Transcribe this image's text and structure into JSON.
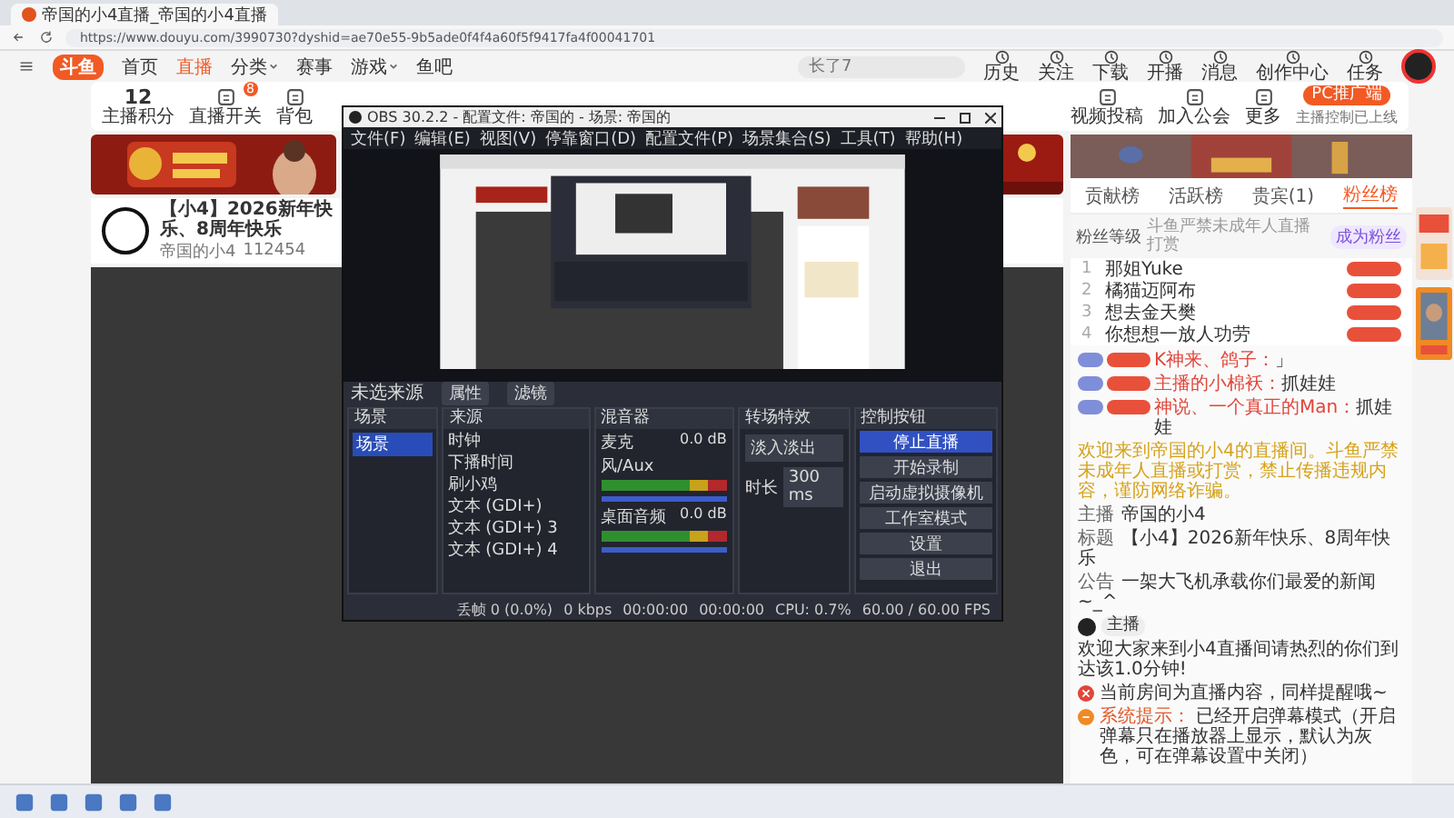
{
  "browser": {
    "tab_title": "帝国的小4直播_帝国的小4直播",
    "url": "https://www.douyu.com/3990730?dyshid=ae70e55-9b5ade0f4f4a60f5f9417fa4f00041701"
  },
  "site_nav": {
    "logo": "斗鱼",
    "items": [
      {
        "label": "首页",
        "selected": false,
        "menu": false
      },
      {
        "label": "直播",
        "selected": true,
        "menu": false
      },
      {
        "label": "分类",
        "selected": false,
        "menu": true
      },
      {
        "label": "赛事",
        "selected": false,
        "menu": false
      },
      {
        "label": "游戏",
        "selected": false,
        "menu": true
      },
      {
        "label": "鱼吧",
        "selected": false,
        "menu": false
      }
    ]
  },
  "search": {
    "placeholder": "长了7"
  },
  "header_links": [
    "历史",
    "关注",
    "下载",
    "开播",
    "消息",
    "创作中心",
    "任务"
  ],
  "toolbar": {
    "score": "12",
    "left": [
      {
        "label": "主播积分"
      },
      {
        "label": "直播开关",
        "badge": "8"
      },
      {
        "label": "背包"
      }
    ],
    "right": [
      {
        "label": "视频投稿"
      },
      {
        "label": "加入公会"
      },
      {
        "label": "更多"
      }
    ],
    "promo_button": "PC推广端",
    "promo_note": "主播控制已上线"
  },
  "room": {
    "title": "【小4】2026新年快乐、8周年快乐",
    "streamer": "帝国的小4",
    "heat": "112454"
  },
  "obs": {
    "title": "OBS 30.2.2 - 配置文件: 帝国的 - 场景: 帝国的",
    "menu": [
      "文件(F)",
      "编辑(E)",
      "视图(V)",
      "停靠窗口(D)",
      "配置文件(P)",
      "场景集合(S)",
      "工具(T)",
      "帮助(H)"
    ],
    "source_bar": {
      "label": "未选来源",
      "buttons": [
        "属性",
        "滤镜"
      ]
    },
    "scenes": {
      "title": "场景",
      "items": [
        {
          "label": "场景",
          "selected": true
        }
      ]
    },
    "sources": {
      "title": "来源",
      "items": [
        "时钟",
        "下播时间",
        "刷小鸡",
        "文本 (GDI+)",
        "文本 (GDI+) 3",
        "文本 (GDI+) 4"
      ]
    },
    "mixer": {
      "title": "混音器",
      "channels": [
        {
          "name": "麦克风/Aux",
          "reading": "0.0 dB",
          "level": 1.0
        },
        {
          "name": "桌面音频",
          "reading": "0.0 dB",
          "level": 1.0
        }
      ]
    },
    "transitions": {
      "title": "转场特效",
      "type": "淡入淡出",
      "duration_label": "时长",
      "duration": "300 ms"
    },
    "controls": {
      "title": "控制按钮",
      "buttons": [
        {
          "label": "停止直播",
          "active": true
        },
        {
          "label": "开始录制",
          "active": false
        },
        {
          "label": "启动虚拟摄像机",
          "active": false
        },
        {
          "label": "工作室模式",
          "active": false
        },
        {
          "label": "设置",
          "active": false
        },
        {
          "label": "退出",
          "active": false
        }
      ]
    },
    "status": [
      "丢帧 0 (0.0%)",
      "0 kbps",
      "00:00:00",
      "00:00:00",
      "CPU: 0.7%",
      "60.00 / 60.00 FPS"
    ]
  },
  "sidebar": {
    "tabs": [
      {
        "label": "贡献榜",
        "selected": false
      },
      {
        "label": "活跃榜",
        "selected": false
      },
      {
        "label": "贵宾(1)",
        "selected": false
      },
      {
        "label": "粉丝榜",
        "selected": true
      }
    ],
    "filter": "粉丝等级",
    "notice": "斗鱼严禁未成年人直播打赏",
    "join": "成为粉丝",
    "ranks": [
      {
        "rank": "1",
        "name": "那姐Yuke"
      },
      {
        "rank": "2",
        "name": "橘猫迈阿布"
      },
      {
        "rank": "3",
        "name": "想去金天樊"
      },
      {
        "rank": "4",
        "name": "你想想一放人功劳"
      }
    ],
    "chat": [
      {
        "kind": "user",
        "user": "K神来、鸽子：",
        "text": "」"
      },
      {
        "kind": "user",
        "user": "主播的小棉袄：",
        "text": "抓娃娃"
      },
      {
        "kind": "user",
        "user": "神说、一个真正的Man：",
        "text": "抓娃娃"
      },
      {
        "kind": "notice",
        "text": "欢迎来到帝国的小4的直播间。斗鱼严禁未成年人直播或打赏，禁止传播违规内容，谨防网络诈骗。"
      },
      {
        "kind": "info",
        "label": "主播",
        "text": "帝国的小4"
      },
      {
        "kind": "info",
        "label": "标题",
        "text": "【小4】2026新年快乐、8周年快乐"
      },
      {
        "kind": "info",
        "label": "公告",
        "text": "一架大飞机承载你们最爱的新闻~_^"
      },
      {
        "kind": "host",
        "user": "主播",
        "text": "欢迎大家来到小4直播间请热烈的你们到达该1.0分钟!"
      },
      {
        "kind": "warning",
        "text": "当前房间为直播内容，同样提醒哦~"
      },
      {
        "kind": "system",
        "label": "系统提示：",
        "text": "已经开启弹幕模式（开启弹幕只在播放器上显示，默认为灰色，可在弹幕设置中关闭）"
      }
    ]
  }
}
